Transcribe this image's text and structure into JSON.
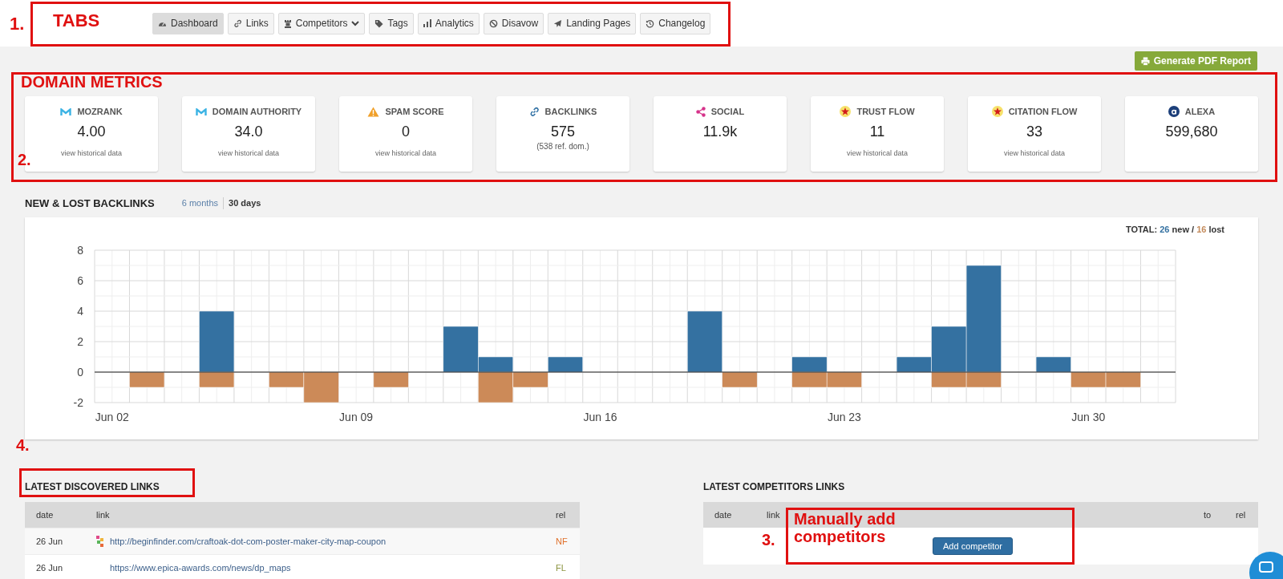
{
  "tabs": [
    {
      "label": "Dashboard",
      "kind": "gauge",
      "selected": true,
      "dropdown": false
    },
    {
      "label": "Links",
      "kind": "link",
      "selected": false,
      "dropdown": false
    },
    {
      "label": "Competitors",
      "kind": "chess",
      "selected": false,
      "dropdown": true
    },
    {
      "label": "Tags",
      "kind": "tag",
      "selected": false,
      "dropdown": false
    },
    {
      "label": "Analytics",
      "kind": "bars",
      "selected": false,
      "dropdown": false
    },
    {
      "label": "Disavow",
      "kind": "ban",
      "selected": false,
      "dropdown": false
    },
    {
      "label": "Landing Pages",
      "kind": "plane",
      "selected": false,
      "dropdown": false
    },
    {
      "label": "Changelog",
      "kind": "history",
      "selected": false,
      "dropdown": false
    }
  ],
  "report_button": "Generate PDF Report",
  "metrics": [
    {
      "kind": "moz",
      "title": "MOZRANK",
      "value": "4.00",
      "footer": {
        "kind": "link",
        "text": "view historical data"
      }
    },
    {
      "kind": "moz",
      "title": "DOMAIN AUTHORITY",
      "value": "34.0",
      "footer": {
        "kind": "link",
        "text": "view historical data"
      }
    },
    {
      "kind": "warning",
      "title": "SPAM SCORE",
      "value": "0",
      "footer": {
        "kind": "link",
        "text": "view historical data"
      }
    },
    {
      "kind": "link",
      "title": "BACKLINKS",
      "value": "575",
      "footer": {
        "kind": "note",
        "text": "(538 ref. dom.)"
      }
    },
    {
      "kind": "share",
      "title": "SOCIAL",
      "value": "11.9k"
    },
    {
      "kind": "star",
      "title": "TRUST FLOW",
      "value": "11",
      "footer": {
        "kind": "link",
        "text": "view historical data"
      }
    },
    {
      "kind": "star",
      "title": "CITATION FLOW",
      "value": "33",
      "footer": {
        "kind": "link",
        "text": "view historical data"
      }
    },
    {
      "kind": "alexa",
      "title": "ALEXA",
      "value": "599,680"
    }
  ],
  "backlinks": {
    "title": "NEW & LOST BACKLINKS",
    "ranges": [
      {
        "label": "6 months",
        "selected": false
      },
      {
        "label": "30 days",
        "selected": true
      }
    ],
    "total": {
      "label": "TOTAL:",
      "new_count": "26",
      "separator": "/",
      "lost_count": "16"
    },
    "chart_data": {
      "type": "bar",
      "stacked": true,
      "grid": true,
      "categories": [
        "Jun 02",
        null,
        null,
        null,
        null,
        null,
        null,
        "Jun 09",
        null,
        null,
        null,
        null,
        null,
        null,
        "Jun 16",
        null,
        null,
        null,
        null,
        null,
        null,
        "Jun 23",
        null,
        null,
        null,
        null,
        null,
        null,
        "Jun 30",
        null,
        null
      ],
      "series": [
        {
          "name": "new",
          "color": "#3471a1",
          "values": [
            0,
            0,
            0,
            4,
            0,
            0,
            0,
            0,
            0,
            0,
            3,
            1,
            0,
            1,
            0,
            0,
            0,
            4,
            0,
            0,
            1,
            0,
            0,
            1,
            3,
            7,
            0,
            1,
            0,
            0,
            0
          ]
        },
        {
          "name": "lost",
          "color": "#cc8a58",
          "values": [
            0,
            -1,
            0,
            -1,
            0,
            -1,
            -2,
            0,
            -1,
            0,
            0,
            -2,
            -1,
            0,
            0,
            0,
            0,
            0,
            -1,
            0,
            -1,
            -1,
            0,
            0,
            -1,
            -1,
            0,
            0,
            -1,
            -1,
            0
          ]
        }
      ],
      "ylim": [
        -2,
        8
      ],
      "yticks": [
        -2,
        0,
        2,
        4,
        6,
        8
      ]
    }
  },
  "discovered": {
    "title": "LATEST DISCOVERED LINKS",
    "columns": [
      "date",
      "link",
      "rel"
    ],
    "rows": [
      {
        "date": "26 Jun",
        "link": "http://beginfinder.com/craftoak-dot-com-poster-maker-city-map-coupon",
        "favicon": true,
        "rel": "NF",
        "color": "#e0702a"
      },
      {
        "date": "26 Jun",
        "link": "https://www.epica-awards.com/news/dp_maps",
        "favicon": false,
        "rel": "FL",
        "color": "#8c9440"
      }
    ]
  },
  "competitors": {
    "title": "LATEST COMPETITORS LINKS",
    "columns": [
      "date",
      "link",
      "",
      "to",
      "rel"
    ],
    "button": "Add competitor"
  },
  "annotations": [
    {
      "number": "1.",
      "label": "TABS"
    },
    {
      "number": "2.",
      "label": "DOMAIN METRICS"
    },
    {
      "number": "4."
    },
    {
      "number": "3.",
      "label": "Manually add competitors"
    }
  ]
}
